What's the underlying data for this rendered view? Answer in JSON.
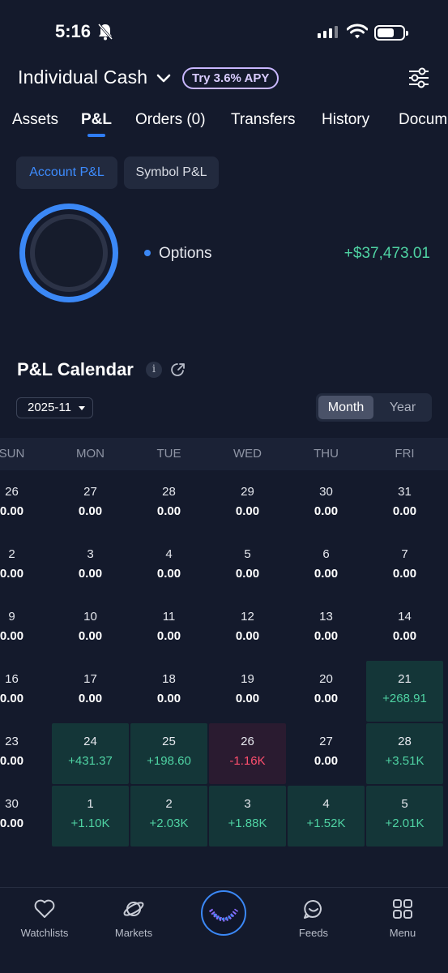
{
  "status": {
    "time": "5:16"
  },
  "header": {
    "account": "Individual Cash",
    "apy_badge": "Try 3.6% APY"
  },
  "tabs": [
    "Assets",
    "P&L",
    "Orders (0)",
    "Transfers",
    "History",
    "Docum"
  ],
  "subtabs": [
    "Account P&L",
    "Symbol P&L"
  ],
  "summary": {
    "label": "Options",
    "value": "+$37,473.01"
  },
  "calendar": {
    "title": "P&L Calendar",
    "month": "2025-11",
    "toggle": [
      "Month",
      "Year"
    ],
    "weekdays": [
      "SUN",
      "MON",
      "TUE",
      "WED",
      "THU",
      "FRI"
    ],
    "weeks": [
      [
        {
          "d": "26",
          "v": "0.00"
        },
        {
          "d": "27",
          "v": "0.00"
        },
        {
          "d": "28",
          "v": "0.00"
        },
        {
          "d": "29",
          "v": "0.00"
        },
        {
          "d": "30",
          "v": "0.00"
        },
        {
          "d": "31",
          "v": "0.00"
        }
      ],
      [
        {
          "d": "2",
          "v": "0.00"
        },
        {
          "d": "3",
          "v": "0.00"
        },
        {
          "d": "4",
          "v": "0.00"
        },
        {
          "d": "5",
          "v": "0.00"
        },
        {
          "d": "6",
          "v": "0.00"
        },
        {
          "d": "7",
          "v": "0.00"
        }
      ],
      [
        {
          "d": "9",
          "v": "0.00"
        },
        {
          "d": "10",
          "v": "0.00"
        },
        {
          "d": "11",
          "v": "0.00"
        },
        {
          "d": "12",
          "v": "0.00"
        },
        {
          "d": "13",
          "v": "0.00"
        },
        {
          "d": "14",
          "v": "0.00"
        }
      ],
      [
        {
          "d": "16",
          "v": "0.00"
        },
        {
          "d": "17",
          "v": "0.00"
        },
        {
          "d": "18",
          "v": "0.00"
        },
        {
          "d": "19",
          "v": "0.00"
        },
        {
          "d": "20",
          "v": "0.00"
        },
        {
          "d": "21",
          "v": "+268.91",
          "s": "pos"
        }
      ],
      [
        {
          "d": "23",
          "v": "0.00"
        },
        {
          "d": "24",
          "v": "+431.37",
          "s": "pos"
        },
        {
          "d": "25",
          "v": "+198.60",
          "s": "pos"
        },
        {
          "d": "26",
          "v": "-1.16K",
          "s": "neg"
        },
        {
          "d": "27",
          "v": "0.00"
        },
        {
          "d": "28",
          "v": "+3.51K",
          "s": "pos"
        }
      ],
      [
        {
          "d": "30",
          "v": "0.00"
        },
        {
          "d": "1",
          "v": "+1.10K",
          "s": "pos"
        },
        {
          "d": "2",
          "v": "+2.03K",
          "s": "pos"
        },
        {
          "d": "3",
          "v": "+1.88K",
          "s": "pos"
        },
        {
          "d": "4",
          "v": "+1.52K",
          "s": "pos"
        },
        {
          "d": "5",
          "v": "+2.01K",
          "s": "pos"
        }
      ]
    ]
  },
  "nav": [
    "Watchlists",
    "Markets",
    "Feeds",
    "Menu"
  ],
  "colors": {
    "accent": "#3b88f6",
    "positive": "#4fd3a3",
    "negative": "#ff4f6e",
    "background": "#141a2c"
  },
  "icons": [
    "bell-off-icon",
    "signal-icon",
    "wifi-icon",
    "battery-icon",
    "chevron-down-icon",
    "filter-icon",
    "info-icon",
    "share-icon",
    "heart-icon",
    "planet-icon",
    "smile-chat-icon",
    "grid-icon"
  ]
}
